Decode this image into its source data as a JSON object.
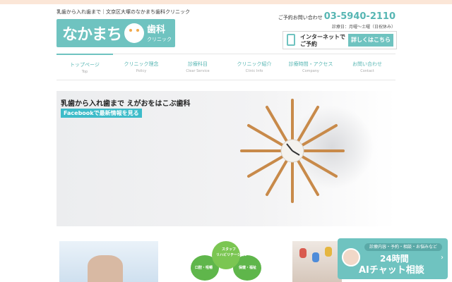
{
  "header": {
    "tagline": "乳歯から入れ歯まで｜文京区大塚のなかまち歯科クリニック",
    "logo": {
      "main": "なかまち",
      "kanji": "歯科",
      "sub": "クリニック"
    },
    "contact": {
      "label": "ご予約お問い合わせ",
      "phone": "03-5940-2110",
      "hours": "診療日：月曜〜土曜（日祝休み）"
    },
    "net_reservation": {
      "line1": "インターネットで",
      "line2": "ご予約",
      "button": "詳しくはこちら"
    }
  },
  "nav": [
    {
      "jp": "トップページ",
      "en": "Top",
      "active": true
    },
    {
      "jp": "クリニック理念",
      "en": "Policy"
    },
    {
      "jp": "診療科目",
      "en": "Clear Service"
    },
    {
      "jp": "クリニック紹介",
      "en": "Clinic Info"
    },
    {
      "jp": "診療時間・アクセス",
      "en": "Company"
    },
    {
      "jp": "お問い合わせ",
      "en": "Contact"
    }
  ],
  "hero": {
    "headline": "乳歯から入れ歯まで えがおをはこぶ歯科",
    "facebook_link": "Facebookで最新情報を見る"
  },
  "cards": {
    "card2_labels": [
      "スタッフ",
      "リハビリテーション",
      "口腔・咀嚼",
      "保健・福祉"
    ]
  },
  "ai_chat": {
    "subtitle": "診療内容・予約・相談・お悩みなど",
    "line1": "24時間",
    "line2": "AIチャット相談",
    "chevron": "›"
  },
  "colors": {
    "accent": "#6fc3c0",
    "facebook": "#3dbcc9",
    "topbar": "#fbe6d7"
  }
}
